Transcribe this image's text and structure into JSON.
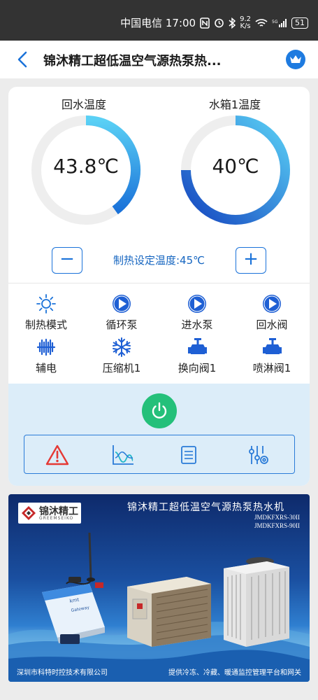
{
  "status_bar": {
    "carrier_time": "中国电信 17:00",
    "net_speed_value": "9.2",
    "net_speed_unit": "K/s",
    "battery": "51"
  },
  "header": {
    "title": "锦沐精工超低温空气源热泵热..."
  },
  "gauges": {
    "return_water": {
      "label": "回水温度",
      "value": "43.8℃",
      "fill": 0.4
    },
    "tank1": {
      "label": "水箱1温度",
      "value": "40℃",
      "fill": 0.75
    }
  },
  "setpoint": {
    "minus": "−",
    "plus": "+",
    "label": "制热设定温度:45℃"
  },
  "status_items": [
    {
      "label": "制热模式",
      "icon": "sun-icon"
    },
    {
      "label": "循环泵",
      "icon": "play-circle-icon"
    },
    {
      "label": "进水泵",
      "icon": "play-circle-icon"
    },
    {
      "label": "回水阀",
      "icon": "play-circle-icon"
    },
    {
      "label": "辅电",
      "icon": "heater-icon"
    },
    {
      "label": "压缩机1",
      "icon": "snowflake-icon"
    },
    {
      "label": "换向阀1",
      "icon": "valve-icon"
    },
    {
      "label": "喷淋阀1",
      "icon": "valve-icon"
    }
  ],
  "colors": {
    "accent": "#1a72d9",
    "power": "#24c07a",
    "alarm": "#e53935",
    "panel": "#dcedf9"
  },
  "banner": {
    "brand_name": "锦沐精工",
    "brand_sub": "GREEMSEIKO",
    "title": "锦沐精工超低温空气源热泵热水机",
    "model_1": "JMDKFXRS-30II",
    "model_2": "JMDKFXRS-90II",
    "footer_left": "深圳市科特时控技术有限公司",
    "footer_right": "提供冷冻、冷藏、暖通监控管理平台和网关",
    "gateway_brand": "kmt",
    "gateway_model": "Gateway"
  }
}
